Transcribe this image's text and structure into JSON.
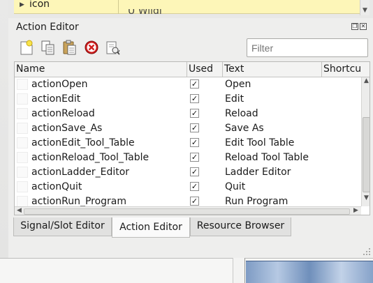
{
  "property_row": {
    "name": "icon",
    "value": "U Wildi"
  },
  "dock": {
    "title": "Action Editor",
    "filter_placeholder": "Filter"
  },
  "toolbar": {
    "new_icon": "new-action-icon",
    "copy_icon": "copy-icon",
    "paste_icon": "paste-icon",
    "delete_icon": "delete-icon",
    "configure_icon": "configure-icon"
  },
  "table": {
    "columns": [
      "Name",
      "Used",
      "Text",
      "Shortcut"
    ],
    "rows": [
      {
        "name": "actionOpen",
        "used": true,
        "text": "Open"
      },
      {
        "name": "actionEdit",
        "used": true,
        "text": "Edit"
      },
      {
        "name": "actionReload",
        "used": true,
        "text": "Reload"
      },
      {
        "name": "actionSave_As",
        "used": true,
        "text": "Save As"
      },
      {
        "name": "actionEdit_Tool_Table",
        "used": true,
        "text": "Edit Tool Table"
      },
      {
        "name": "actionReload_Tool_Table",
        "used": true,
        "text": "Reload Tool Table"
      },
      {
        "name": "actionLadder_Editor",
        "used": true,
        "text": "Ladder Editor"
      },
      {
        "name": "actionQuit",
        "used": true,
        "text": "Quit"
      },
      {
        "name": "actionRun_Program",
        "used": true,
        "text": "Run Program"
      }
    ],
    "check_glyph": "✓"
  },
  "tabs": [
    {
      "label": "Signal/Slot Editor",
      "active": false
    },
    {
      "label": "Action Editor",
      "active": true
    },
    {
      "label": "Resource Browser",
      "active": false
    }
  ],
  "colors": {
    "property_highlight": "#fdf6b8",
    "active_tab": "#fafafa"
  }
}
